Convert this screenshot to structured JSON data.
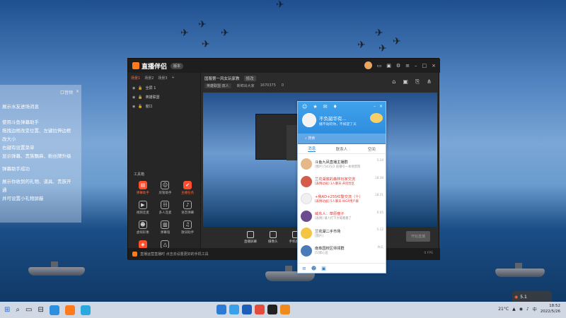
{
  "left_panel": {
    "header_text": "口音频",
    "lines": [
      "展示水友进场消息",
      "使用斗鱼弹幕助手",
      "拖拽边框改变位置、左键拉伸边框",
      "改大小",
      "右键有设置菜单",
      "显示弹幕、贵族飘麻、粉丝牌升级",
      "弹幕助手成功",
      "展示你收到的礼物、道具、贵族开",
      "通",
      "并可设置小礼物屏蔽"
    ]
  },
  "app": {
    "name": "直播伴侣",
    "version": "版本",
    "scene_tabs": [
      "场景1",
      "场景2",
      "场景3",
      "+"
    ],
    "sources": [
      "全屏 1",
      "英雄联盟",
      "窗口"
    ],
    "toolbox_title": "工具箱",
    "tools": [
      "弹幕助手",
      "房管助手",
      "主播任务",
      "视频连麦",
      "多人连麦",
      "语音弹幕",
      "虚拟形象",
      "弹幕墙",
      "歌词助手",
      "分区",
      "更多"
    ],
    "room_title": "国服第一风女玩家教",
    "room_tag": "修改",
    "room_category": "英雄联盟·双人",
    "room_sub": "新鲜出大家",
    "room_count": "1670375",
    "room_heat": "0",
    "bottom_tools": [
      "直播屏幕",
      "摄像头",
      "手机投屏"
    ],
    "live_button": "开始直播",
    "notice": "直播运营直播时 点击去设置更好的手机工具",
    "fps": "0 FPS"
  },
  "qq": {
    "nickname": "不负韶华有...",
    "signature": "播不动的你，不如逆了天",
    "search_placeholder": "搜索",
    "tabs": [
      "消息",
      "联系人",
      "空间"
    ],
    "chats": [
      {
        "name": "斗鱼九凤直播主播群",
        "preview": "[图片] 5435/2 直播号一本地营销",
        "time": "5-24",
        "red": false
      },
      {
        "name": "兰花湖底的森林玩家交流",
        "preview": "[表情动画] 3人聊天·开团合区",
        "time": "18:38",
        "red": true
      },
      {
        "name": "+我AD+255红警交流（十）",
        "preview": "[表情动画] 5人聊天·WGP用户群",
        "time": "18:31",
        "red": true
      },
      {
        "name": "威东人：草原瘦子",
        "preview": "[表情] 请人打下大喊看看了",
        "time": "6:05",
        "red": true
      },
      {
        "name": "兰花湖二手市场",
        "preview": "[图片]",
        "time": "5-12",
        "red": false
      },
      {
        "name": "南阜园校区师领群",
        "preview": "[5]新心区",
        "time": "昨天",
        "red": false
      }
    ]
  },
  "desktop_pop": "5.1",
  "taskbar": {
    "temp": "21°C",
    "time": "18:52",
    "date": "2022/5/26"
  }
}
